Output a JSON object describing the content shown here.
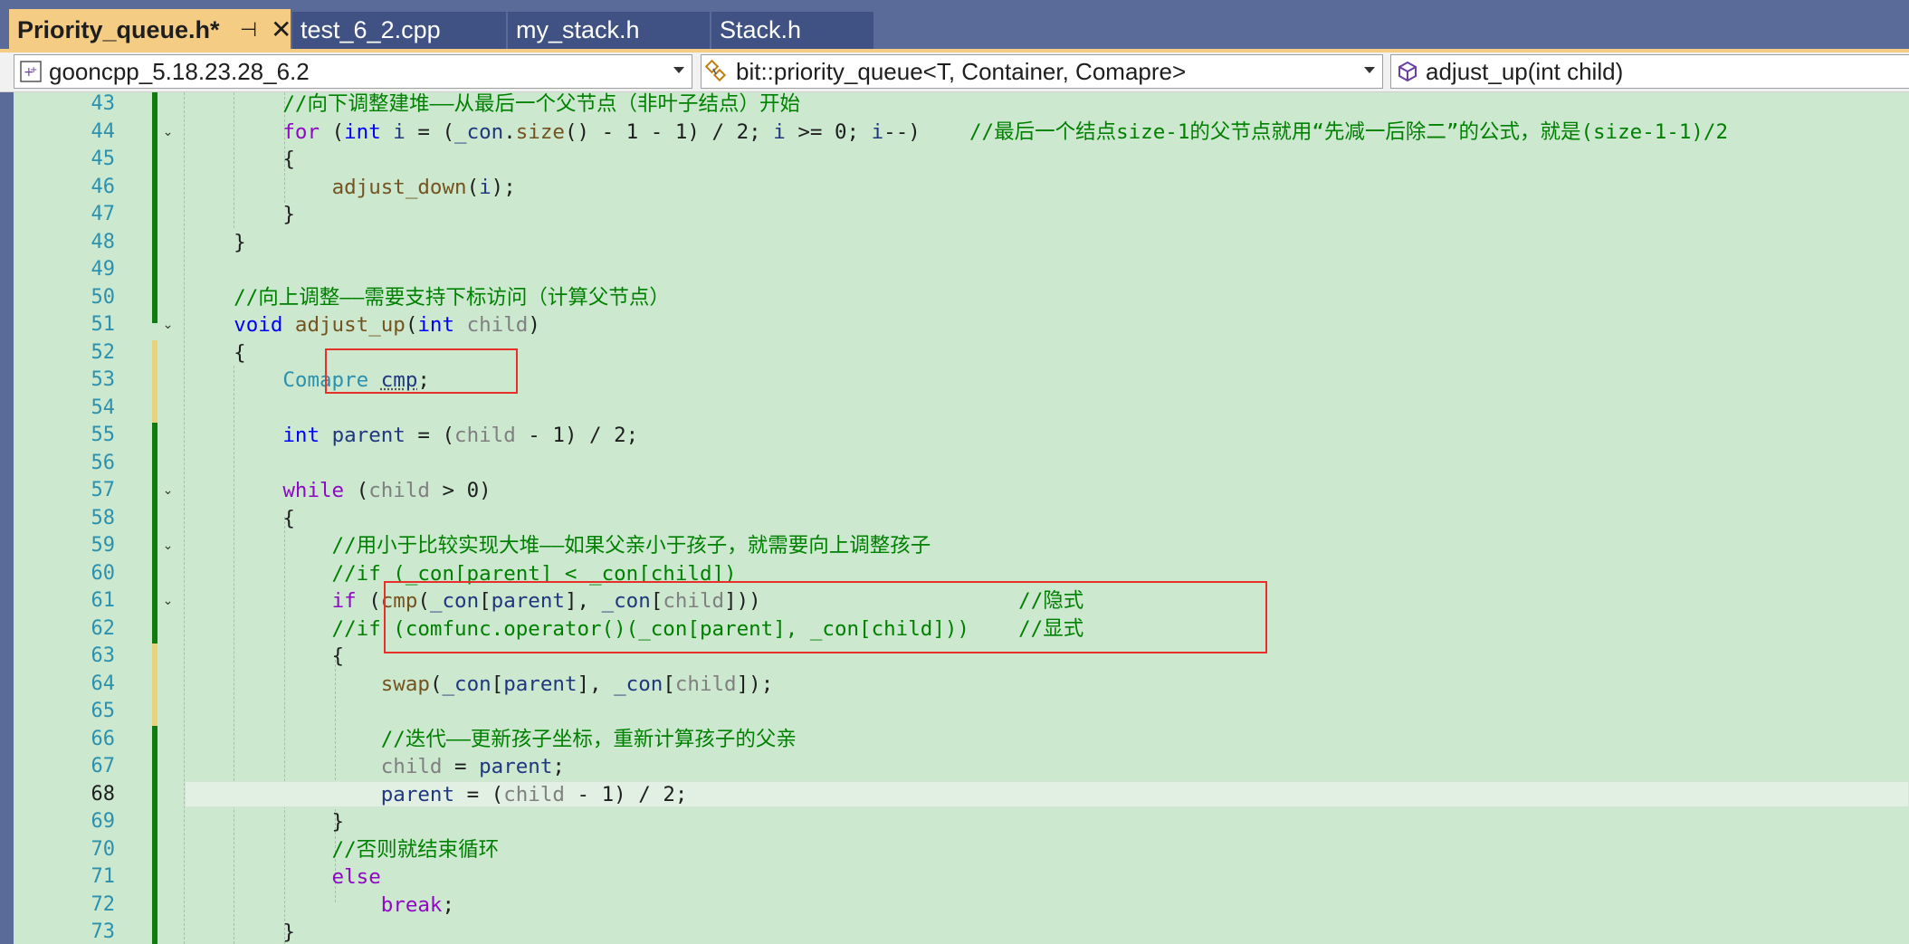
{
  "tabs": [
    {
      "label": "Priority_queue.h*",
      "active": true,
      "pin": "⊣",
      "close": "✕"
    },
    {
      "label": "test_6_2.cpp",
      "active": false
    },
    {
      "label": "my_stack.h",
      "active": false
    },
    {
      "label": "Stack.h",
      "active": false
    }
  ],
  "nav": {
    "project": "gooncpp_5.18.23.28_6.2",
    "scope": "bit::priority_queue<T, Container, Comapre>",
    "member": "adjust_up(int child)"
  },
  "editor": {
    "current_line": "68",
    "lines": [
      {
        "n": "43",
        "t": "        //向下调整建堆——从最后一个父节点（非叶子结点）开始"
      },
      {
        "n": "44",
        "t": "        for (int i = (_con.size() - 1 - 1) / 2; i >= 0; i--)    //最后一个结点size-1的父节点就用“先减一后除二”的公式，就是(size-1-1)/2"
      },
      {
        "n": "45",
        "t": "        {"
      },
      {
        "n": "46",
        "t": "            adjust_down(i);"
      },
      {
        "n": "47",
        "t": "        }"
      },
      {
        "n": "48",
        "t": "    }"
      },
      {
        "n": "49",
        "t": ""
      },
      {
        "n": "50",
        "t": "    //向上调整——需要支持下标访问（计算父节点）"
      },
      {
        "n": "51",
        "t": "    void adjust_up(int child)"
      },
      {
        "n": "52",
        "t": "    {"
      },
      {
        "n": "53",
        "t": "        Comapre cmp;"
      },
      {
        "n": "54",
        "t": ""
      },
      {
        "n": "55",
        "t": "        int parent = (child - 1) / 2;"
      },
      {
        "n": "56",
        "t": ""
      },
      {
        "n": "57",
        "t": "        while (child > 0)"
      },
      {
        "n": "58",
        "t": "        {"
      },
      {
        "n": "59",
        "t": "            //用小于比较实现大堆——如果父亲小于孩子，就需要向上调整孩子"
      },
      {
        "n": "60",
        "t": "            //if (_con[parent] < _con[child])"
      },
      {
        "n": "61",
        "t": "            if (cmp(_con[parent], _con[child]))                     //隐式"
      },
      {
        "n": "62",
        "t": "            //if (comfunc.operator()(_con[parent], _con[child]))    //显式"
      },
      {
        "n": "63",
        "t": "            {"
      },
      {
        "n": "64",
        "t": "                swap(_con[parent], _con[child]);"
      },
      {
        "n": "65",
        "t": ""
      },
      {
        "n": "66",
        "t": "                //迭代——更新孩子坐标，重新计算孩子的父亲"
      },
      {
        "n": "67",
        "t": "                child = parent;"
      },
      {
        "n": "68",
        "t": "                parent = (child - 1) / 2;"
      },
      {
        "n": "69",
        "t": "            }"
      },
      {
        "n": "70",
        "t": "            //否则就结束循环"
      },
      {
        "n": "71",
        "t": "            else"
      },
      {
        "n": "72",
        "t": "                break;"
      },
      {
        "n": "73",
        "t": "        }"
      }
    ]
  },
  "colors": {
    "editor_bg": "#cce8cf",
    "tab_active": "#f5cc84",
    "tab_inactive": "#3f5283",
    "chrome": "#5b6b99",
    "annotation_box": "#e8302b",
    "change_saved": "#107c10",
    "change_unsaved": "#e8d27a"
  },
  "icons": {
    "project": "cpp-project-icon",
    "scope": "class-icon",
    "member": "method-cube-icon",
    "pin": "pin-icon",
    "close": "close-icon",
    "fold": "fold-collapse-icon"
  }
}
